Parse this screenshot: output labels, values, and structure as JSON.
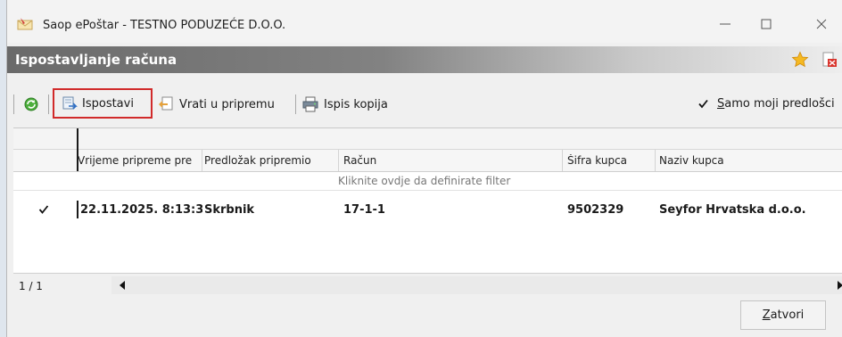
{
  "window": {
    "title": "Saop ePoštar - TESTNO PODUZEĆE D.O.O."
  },
  "module": {
    "title": "Ispostavljanje računa"
  },
  "toolbar": {
    "ispostavi_label": "Ispostavi",
    "vrati_label": "Vrati u pripremu",
    "ispis_label": "Ispis kopija",
    "only_mine_label_first": "S",
    "only_mine_label_rest": "amo moji predlošci",
    "only_mine_checked": true
  },
  "grid": {
    "columns": [
      "Vrijeme pripreme pre",
      "Predložak pripremio",
      "Račun",
      "Šifra kupca",
      "Naziv kupca"
    ],
    "filter_hint": "Kliknite ovdje da definirate filter",
    "rows": [
      {
        "checked": true,
        "vrijeme": "22.11.2025. 8:13:3",
        "pripremio": "Skrbnik",
        "racun": "17-1-1",
        "sifra": "9502329",
        "naziv": "Seyfor Hrvatska d.o.o."
      }
    ],
    "page_indicator": "1 / 1"
  },
  "footer": {
    "close_label_first": "Z",
    "close_label_rest": "atvori"
  },
  "colors": {
    "highlight_border": "#d12a2a",
    "header_gradient_start": "#6a6a6a"
  }
}
